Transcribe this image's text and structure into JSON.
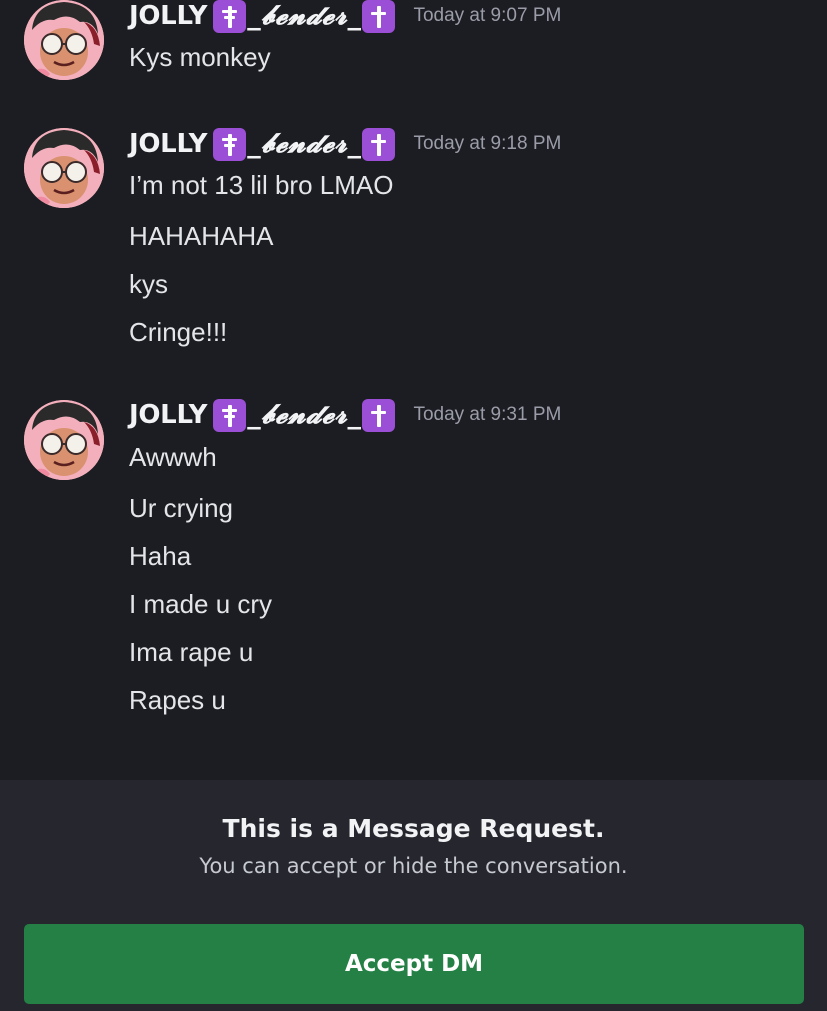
{
  "conversation": {
    "groups": [
      {
        "author": {
          "name": "JOLLY",
          "left_emoji": "orthodox-cross-emoji",
          "fancy_text": "_𝓫𝓮𝓷𝓭𝓮𝓻_",
          "right_emoji": "latin-cross-emoji"
        },
        "timestamp": "Today at 9:07 PM",
        "messages": [
          "Kys monkey"
        ]
      },
      {
        "author": {
          "name": "JOLLY",
          "left_emoji": "orthodox-cross-emoji",
          "fancy_text": "_𝓫𝓮𝓷𝓭𝓮𝓻_",
          "right_emoji": "latin-cross-emoji"
        },
        "timestamp": "Today at 9:18 PM",
        "messages": [
          "I’m not 13 lil bro LMAO",
          "HAHAHAHA",
          "kys",
          "Cringe!!!"
        ]
      },
      {
        "author": {
          "name": "JOLLY",
          "left_emoji": "orthodox-cross-emoji",
          "fancy_text": "_𝓫𝓮𝓷𝓭𝓮𝓻_",
          "right_emoji": "latin-cross-emoji"
        },
        "timestamp": "Today at 9:31 PM",
        "messages": [
          "Awwwh",
          "Ur crying",
          "Haha",
          "I made u cry",
          "Ima rape u",
          "Rapes u"
        ]
      }
    ]
  },
  "request_panel": {
    "title": "This is a Message Request.",
    "subtitle": "You can accept or hide the conversation.",
    "accept_label": "Accept DM"
  },
  "colors": {
    "background": "#1c1d22",
    "panel": "#26272e",
    "accept_button": "#248045",
    "emoji_purple": "#9a4fd6",
    "timestamp": "#9a9ca8"
  }
}
